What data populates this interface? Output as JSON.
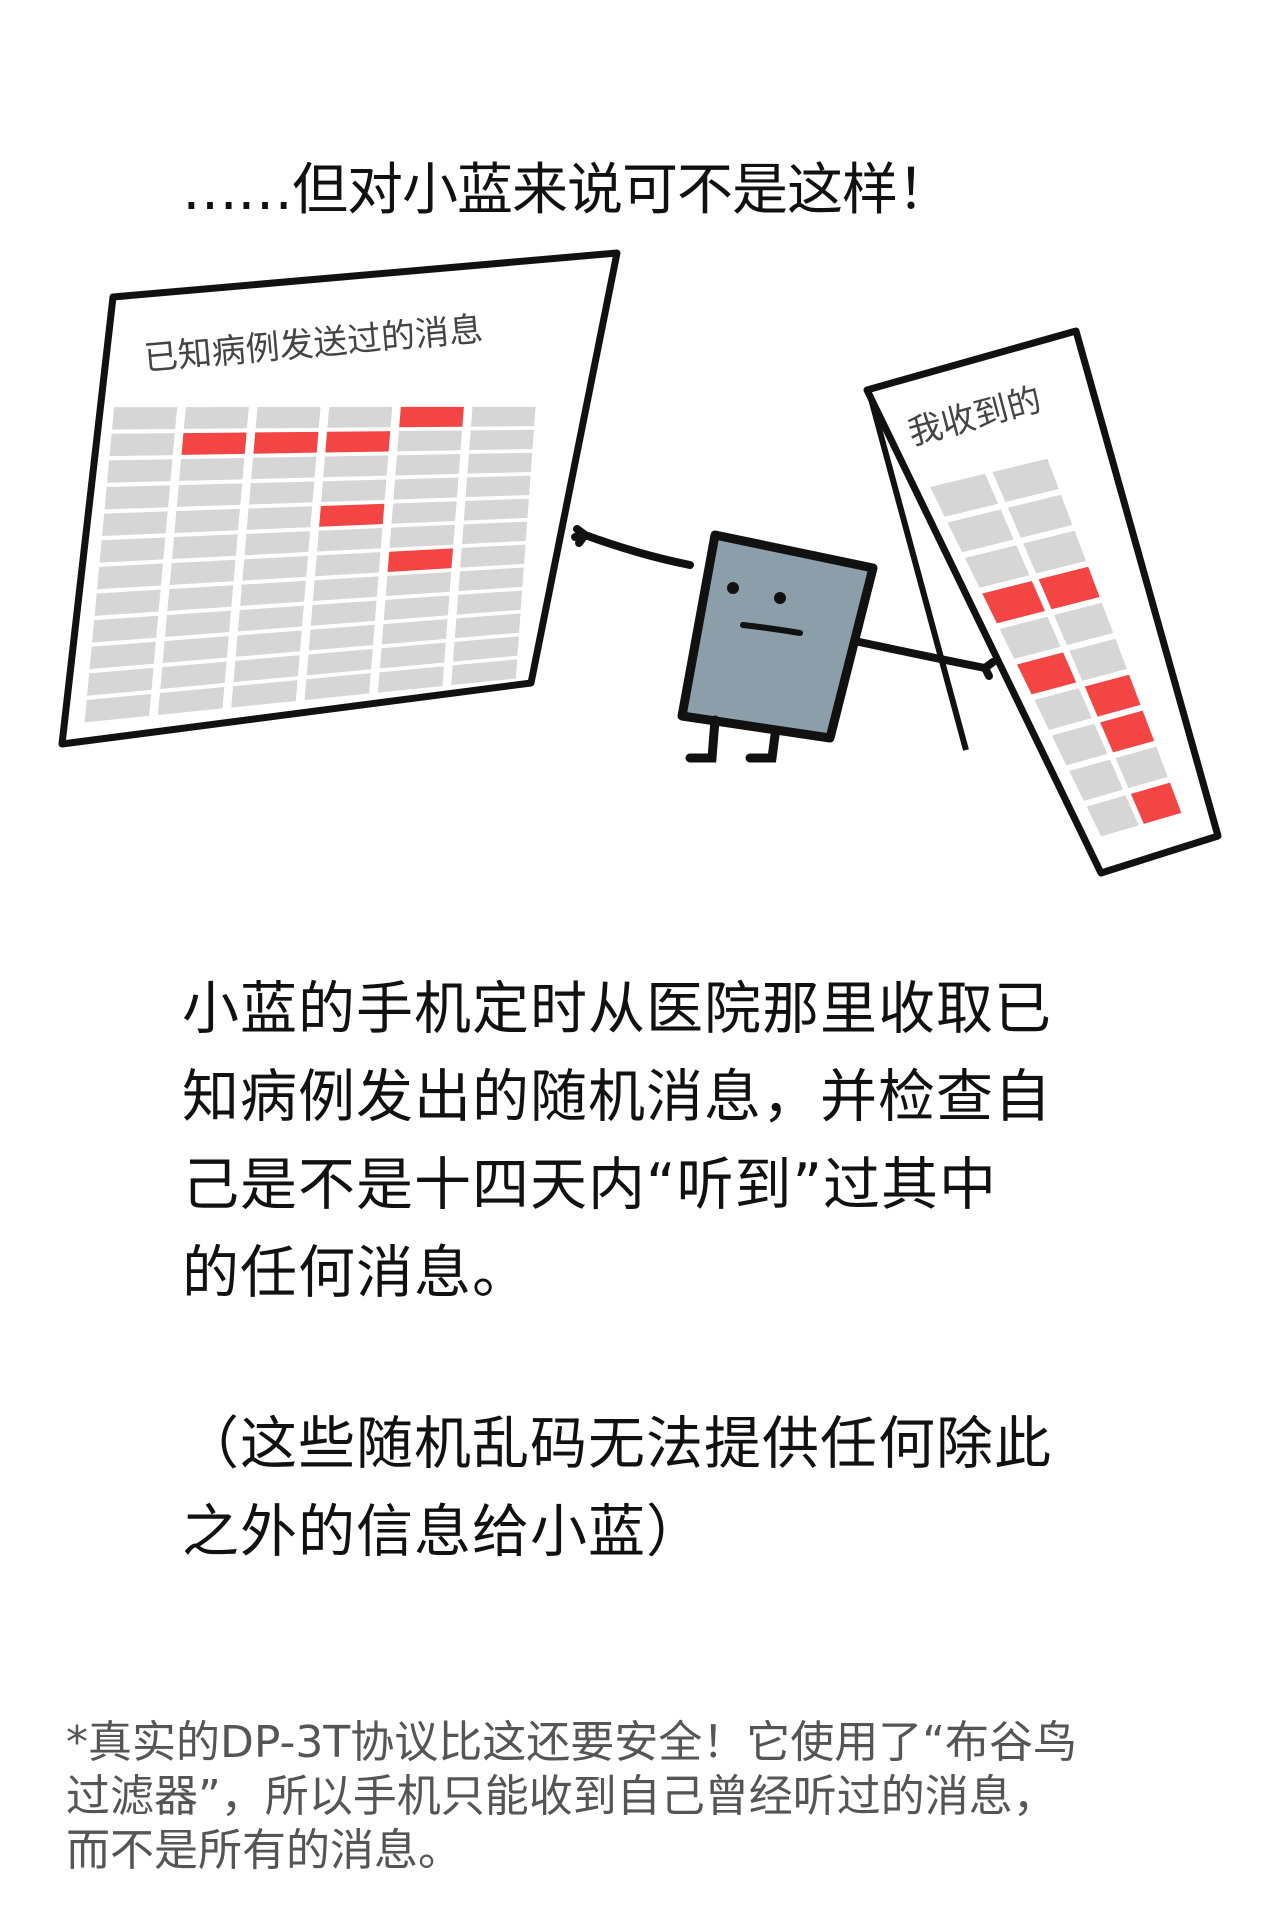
{
  "title": "……但对小蓝来说可不是这样！",
  "left_sheet": {
    "label": "已知病例发送过的消息",
    "rows": 12,
    "cols": 6,
    "highlighted": [
      [
        0,
        4
      ],
      [
        1,
        1
      ],
      [
        1,
        2
      ],
      [
        1,
        3
      ],
      [
        4,
        3
      ],
      [
        6,
        4
      ]
    ]
  },
  "right_sheet": {
    "label": "我收到的",
    "rows": 10,
    "cols": 2,
    "highlighted": [
      [
        3,
        0
      ],
      [
        3,
        1
      ],
      [
        5,
        0
      ],
      [
        6,
        1
      ],
      [
        7,
        1
      ],
      [
        9,
        1
      ]
    ]
  },
  "colors": {
    "red": "#f44545",
    "grey": "#d6d6d6",
    "phone": "#8c9ea9"
  },
  "paragraph1": [
    "小蓝的手机定时从医院那里收取已",
    "知病例发出的随机消息，并检查自",
    "己是不是十四天内“听到”过其中",
    "的任何消息。"
  ],
  "paragraph2": [
    "（这些随机乱码无法提供任何除此",
    "之外的信息给小蓝）"
  ],
  "footnote": [
    "*真实的DP-3T协议比这还要安全！它使用了“布谷鸟",
    "过滤器”，所以手机只能收到自己曾经听过的消息，",
    "而不是所有的消息。"
  ]
}
